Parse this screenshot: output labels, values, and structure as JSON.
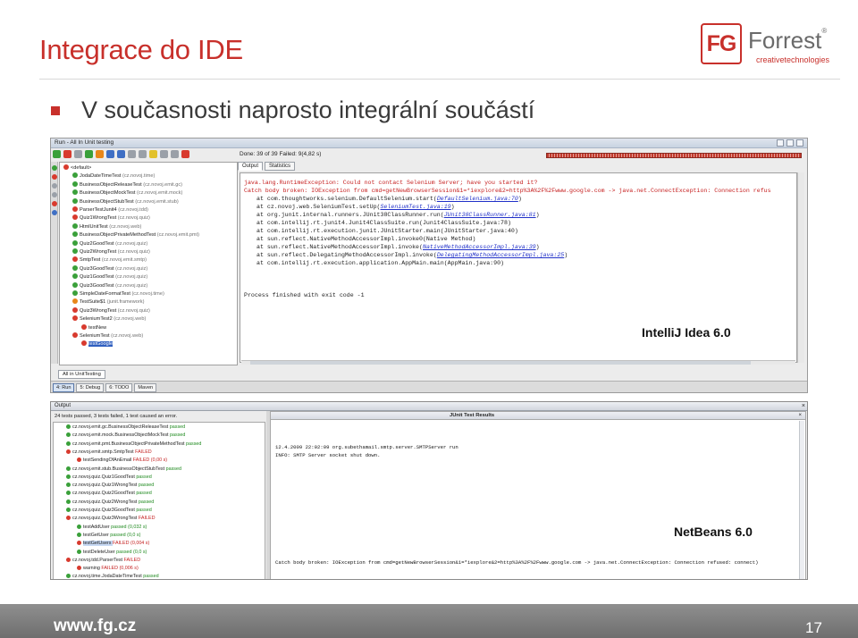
{
  "slide": {
    "title": "Integrace do IDE",
    "bullet": "V současnosti naprosto integrální součástí",
    "footer_url": "www.fg.cz",
    "page_number": "17",
    "logo": {
      "mark": "FG",
      "word": "Forrest",
      "registered": "®",
      "tagline": "creativetechnologies"
    },
    "brand_color": "#c8302b"
  },
  "intellij": {
    "label": "IntelliJ Idea 6.0",
    "window_title": "Run - All In Unit testing",
    "status": "Done: 39 of 39     Failed: 9(4,82 s)",
    "subtabs": [
      "Output",
      "Statistics"
    ],
    "bottom_tab": "All in UnitTesting",
    "statusbar": [
      "4: Run",
      "5: Debug",
      "6: TODO",
      "Maven"
    ],
    "tree": [
      {
        "label": "<default>",
        "pkg": "",
        "status": "fail",
        "depth": 0
      },
      {
        "label": "JodaDateTimeTest",
        "pkg": "(cz.novoj.time)",
        "status": "pass",
        "depth": 1
      },
      {
        "label": "BusinessObjectReleaseTest",
        "pkg": "(cz.novoj.emit.gc)",
        "status": "pass",
        "depth": 1
      },
      {
        "label": "BusinessObjectMockTest",
        "pkg": "(cz.novoj.emit.mock)",
        "status": "pass",
        "depth": 1
      },
      {
        "label": "BusinessObjectStubTest",
        "pkg": "(cz.novoj.emit.stub)",
        "status": "pass",
        "depth": 1
      },
      {
        "label": "ParserTestJunit4",
        "pkg": "(cz.novoj.tdd)",
        "status": "fail",
        "depth": 1
      },
      {
        "label": "Quiz1WrongTest",
        "pkg": "(cz.novoj.quiz)",
        "status": "fail",
        "depth": 1
      },
      {
        "label": "HtmlUnitTest",
        "pkg": "(cz.novoj.web)",
        "status": "pass",
        "depth": 1
      },
      {
        "label": "BusinessObjectPrivateMethodTest",
        "pkg": "(cz.novoj.emit.pmt)",
        "status": "pass",
        "depth": 1
      },
      {
        "label": "Quiz2GoodTest",
        "pkg": "(cz.novoj.quiz)",
        "status": "pass",
        "depth": 1
      },
      {
        "label": "Quiz2WrongTest",
        "pkg": "(cz.novoj.quiz)",
        "status": "pass",
        "depth": 1
      },
      {
        "label": "SmtpTest",
        "pkg": "(cz.novoj.emit.smtp)",
        "status": "fail",
        "depth": 1
      },
      {
        "label": "Quiz3GoodTest",
        "pkg": "(cz.novoj.quiz)",
        "status": "pass",
        "depth": 1
      },
      {
        "label": "Quiz1GoodTest",
        "pkg": "(cz.novoj.quiz)",
        "status": "pass",
        "depth": 1
      },
      {
        "label": "Quiz3GoodTest",
        "pkg": "(cz.novoj.quiz)",
        "status": "pass",
        "depth": 1
      },
      {
        "label": "SimpleDateFormatTest",
        "pkg": "(cz.novoj.time)",
        "status": "pass",
        "depth": 1
      },
      {
        "label": "TestSuite$1",
        "pkg": "(junit.framework)",
        "status": "warn",
        "depth": 1
      },
      {
        "label": "Quiz3WrongTest",
        "pkg": "(cz.novoj.quiz)",
        "status": "fail",
        "depth": 1
      },
      {
        "label": "SeleniumTest2",
        "pkg": "(cz.novoj.web)",
        "status": "fail",
        "depth": 1
      },
      {
        "label": "testNew",
        "pkg": "",
        "status": "fail",
        "depth": 2
      },
      {
        "label": "SeleniumTest",
        "pkg": "(cz.novoj.web)",
        "status": "fail",
        "depth": 1
      },
      {
        "label": "testGoogle",
        "pkg": "",
        "status": "fail",
        "depth": 2,
        "selected": true
      }
    ],
    "console": [
      {
        "t": "err",
        "text": "java.lang.RuntimeException: Could not contact Selenium Server; have you started it?"
      },
      {
        "t": "err",
        "text": "Catch body broken: IOException from cmd=getNewBrowserSession&1=*iexplore&2=http%3A%2F%2Fwww.google.com -> java.net.ConnectException: Connection refus"
      },
      {
        "t": "trace",
        "text": "at com.thoughtworks.selenium.DefaultSelenium.start(",
        "link": "DefaultSelenium.java:70",
        "tail": ")"
      },
      {
        "t": "trace",
        "text": "at cz.novoj.web.SeleniumTest.setUp(",
        "link": "SeleniumTest.java:19",
        "tail": ")"
      },
      {
        "t": "trace",
        "text": "at org.junit.internal.runners.JUnit38ClassRunner.run(",
        "link": "JUnit38ClassRunner.java:81",
        "tail": ")"
      },
      {
        "t": "trace",
        "text": "at com.intellij.rt.junit4.Junit4ClassSuite.run(Junit4ClassSuite.java:78)",
        "link": "",
        "tail": ""
      },
      {
        "t": "trace",
        "text": "at com.intellij.rt.execution.junit.JUnitStarter.main(JUnitStarter.java:40)",
        "link": "",
        "tail": ""
      },
      {
        "t": "trace",
        "text": "at sun.reflect.NativeMethodAccessorImpl.invoke0(Native Method)",
        "link": "",
        "tail": ""
      },
      {
        "t": "trace",
        "text": "at sun.reflect.NativeMethodAccessorImpl.invoke(",
        "link": "NativeMethodAccessorImpl.java:39",
        "tail": ")"
      },
      {
        "t": "trace",
        "text": "at sun.reflect.DelegatingMethodAccessorImpl.invoke(",
        "link": "DelegatingMethodAccessorImpl.java:25",
        "tail": ")"
      },
      {
        "t": "trace",
        "text": "at com.intellij.rt.execution.application.AppMain.main(AppMain.java:90)",
        "link": "",
        "tail": ""
      },
      {
        "t": "plain",
        "text": ""
      },
      {
        "t": "plain",
        "text": "Process finished with exit code -1"
      }
    ]
  },
  "netbeans": {
    "label": "NetBeans 6.0",
    "output_title": "Output",
    "results_title": "JUnit Test Results",
    "summary": "24 tests passed, 3 tests failed, 1 test caused an error.",
    "tree": [
      {
        "label": "cz.novoj.emit.gc.BusinessObjectReleaseTest",
        "status": "passed",
        "depth": 0
      },
      {
        "label": "cz.novoj.emit.mock.BusinessObjectMockTest",
        "status": "passed",
        "depth": 0
      },
      {
        "label": "cz.novoj.emit.pmt.BusinessObjectPrivateMethodTest",
        "status": "passed",
        "depth": 0
      },
      {
        "label": "cz.novoj.emit.smtp.SmtpTest",
        "status": "FAILED",
        "depth": 0
      },
      {
        "label": "testSendingOfAnEmail",
        "status": "FAILED (0,00 s)",
        "depth": 1
      },
      {
        "label": "cz.novoj.emit.stub.BusinessObjectStubTest",
        "status": "passed",
        "depth": 0
      },
      {
        "label": "cz.novoj.quiz.Quiz1GoodTest",
        "status": "passed",
        "depth": 0
      },
      {
        "label": "cz.novoj.quiz.Quiz1WrongTest",
        "status": "passed",
        "depth": 0
      },
      {
        "label": "cz.novoj.quiz.Quiz2GoodTest",
        "status": "passed",
        "depth": 0
      },
      {
        "label": "cz.novoj.quiz.Quiz2WrongTest",
        "status": "passed",
        "depth": 0
      },
      {
        "label": "cz.novoj.quiz.Quiz3GoodTest",
        "status": "passed",
        "depth": 0
      },
      {
        "label": "cz.novoj.quiz.Quiz3WrongTest",
        "status": "FAILED",
        "depth": 0
      },
      {
        "label": "testAddUser",
        "status": "passed (0,032 s)",
        "depth": 1
      },
      {
        "label": "testGetUser",
        "status": "passed (0,0 s)",
        "depth": 1
      },
      {
        "label": "testGetUsers",
        "status": "FAILED (0,004 s)",
        "depth": 1,
        "selected": true
      },
      {
        "label": "testDeleteUser",
        "status": "passed (0,0 s)",
        "depth": 1
      },
      {
        "label": "cz.novoj.tdd.ParserTest",
        "status": "FAILED",
        "depth": 0
      },
      {
        "label": "warning",
        "status": "FAILED (0,006 s)",
        "depth": 1
      },
      {
        "label": "cz.novoj.time.JodaDateTimeTest",
        "status": "passed",
        "depth": 0
      }
    ],
    "console": [
      "12.4.2009 22:02:09 org.subethamail.smtp.server.SMTPServer run",
      "INFO: SMTP Server socket shut down."
    ],
    "console_bottom": "Catch body broken: IOException from cmd=getNewBrowserSession&1=*iexplore&2=http%3A%2F%2Fwww.google.com -> java.net.ConnectException: Connection refused: connect)"
  }
}
